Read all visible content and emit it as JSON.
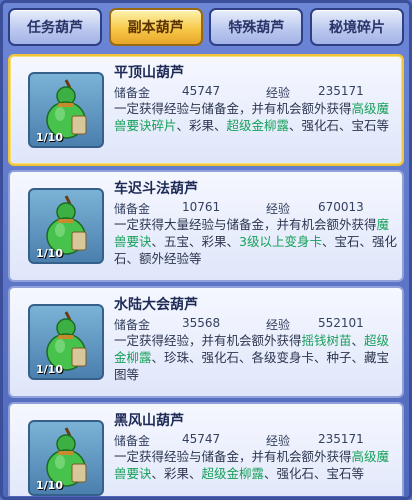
{
  "tabs": [
    {
      "label": "任务葫芦",
      "active": false
    },
    {
      "label": "副本葫芦",
      "active": true
    },
    {
      "label": "特殊葫芦",
      "active": false
    },
    {
      "label": "秘境碎片",
      "active": false
    }
  ],
  "items": [
    {
      "title": "平顶山葫芦",
      "reserve_label": "储备金",
      "reserve": "45747",
      "exp_label": "经验",
      "exp": "235171",
      "count": "1/10",
      "desc": [
        {
          "t": "一定获得经验与储备金，并有机会额外获得",
          "g": false
        },
        {
          "t": "高级魔兽要诀碎片",
          "g": true
        },
        {
          "t": "、彩果、",
          "g": false
        },
        {
          "t": "超级金柳露",
          "g": true
        },
        {
          "t": "、强化石、宝石等",
          "g": false
        }
      ]
    },
    {
      "title": "车迟斗法葫芦",
      "reserve_label": "储备金",
      "reserve": "10761",
      "exp_label": "经验",
      "exp": "670013",
      "count": "1/10",
      "desc": [
        {
          "t": "一定获得大量经验与储备金，并有机会额外获得",
          "g": false
        },
        {
          "t": "魔兽要诀",
          "g": true
        },
        {
          "t": "、五宝、彩果、",
          "g": false
        },
        {
          "t": "3级以上变身卡",
          "g": true
        },
        {
          "t": "、宝石、强化石、额外经验等",
          "g": false
        }
      ]
    },
    {
      "title": "水陆大会葫芦",
      "reserve_label": "储备金",
      "reserve": "35568",
      "exp_label": "经验",
      "exp": "552101",
      "count": "1/10",
      "desc": [
        {
          "t": "一定获得经验，并有机会额外获得",
          "g": false
        },
        {
          "t": "摇钱树苗",
          "g": true
        },
        {
          "t": "、",
          "g": false
        },
        {
          "t": "超级金柳露",
          "g": true
        },
        {
          "t": "、珍珠、强化石、各级变身卡、种子、藏宝图等",
          "g": false
        }
      ]
    },
    {
      "title": "黑风山葫芦",
      "reserve_label": "储备金",
      "reserve": "45747",
      "exp_label": "经验",
      "exp": "235171",
      "count": "1/10",
      "desc": [
        {
          "t": "一定获得经验与储备金，并有机会额外获得",
          "g": false
        },
        {
          "t": "高级魔兽要诀",
          "g": true
        },
        {
          "t": "、彩果、",
          "g": false
        },
        {
          "t": "超级金柳露",
          "g": true
        },
        {
          "t": "、强化石、宝石等",
          "g": false
        }
      ]
    }
  ]
}
